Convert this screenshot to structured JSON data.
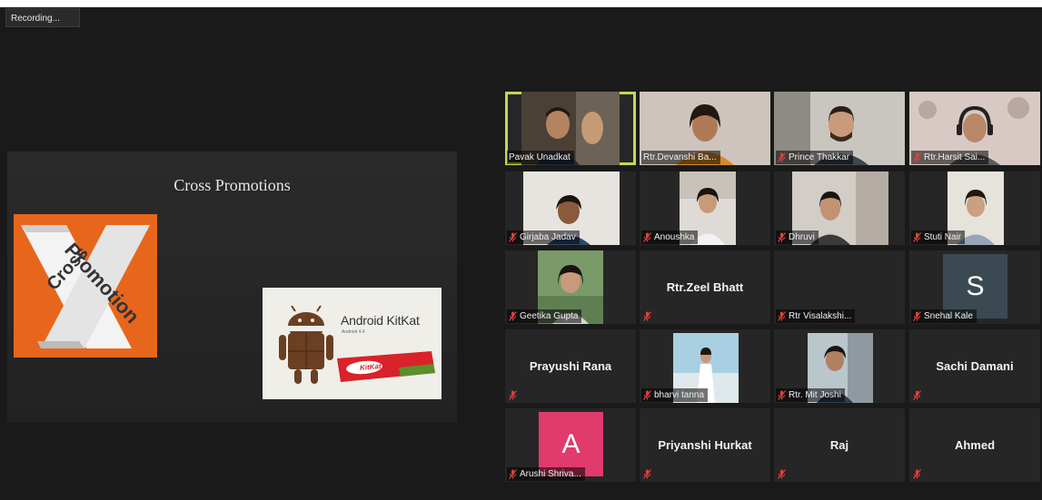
{
  "recording_label": "Recording...",
  "slide": {
    "title": "Cross Promotions",
    "logo_text": "Promotion Cross",
    "kitkat_title": "Android KitKat",
    "kitkat_sub": "Android 4.4",
    "kitkat_wrapper": "KitKat"
  },
  "colors": {
    "active_speaker": "#c8d94a",
    "muted_mic": "#e0403a",
    "tile_bg": "#262626",
    "avatar_snehal": "#3b4a52",
    "avatar_arushi": "#e13a6d"
  },
  "participants": [
    {
      "name": "Pavak Unadkat",
      "video": true,
      "muted": false,
      "active": true
    },
    {
      "name": "Rtr.Devanshi Ba...",
      "video": true,
      "muted": false
    },
    {
      "name": "Prince Thakkar",
      "video": true,
      "muted": true
    },
    {
      "name": "Rtr.Harsit Sai...",
      "video": true,
      "muted": true
    },
    {
      "name": "Girjaba Jadav",
      "video": true,
      "muted": true
    },
    {
      "name": "Anoushka",
      "video": true,
      "muted": true
    },
    {
      "name": "Dhruvi",
      "video": true,
      "muted": true
    },
    {
      "name": "Stuti Nair",
      "video": true,
      "muted": true
    },
    {
      "name": "Geetika Gupta",
      "video": true,
      "muted": true
    },
    {
      "name": "Rtr.Zeel Bhatt",
      "video": false,
      "muted": true
    },
    {
      "name": "Rtr Visalakshi...",
      "video": false,
      "muted": true
    },
    {
      "name": "Snehal Kale",
      "video": false,
      "muted": true,
      "avatar_letter": "S"
    },
    {
      "name": "Prayushi Rana",
      "video": false,
      "muted": true
    },
    {
      "name": "bharvi tanna",
      "video": true,
      "muted": true
    },
    {
      "name": "Rtr. Mit Joshi",
      "video": true,
      "muted": true
    },
    {
      "name": "Sachi Damani",
      "video": false,
      "muted": true
    },
    {
      "name": "Arushi Shriva...",
      "video": false,
      "muted": true,
      "avatar_letter": "A"
    },
    {
      "name": "Priyanshi Hurkat",
      "video": false,
      "muted": true
    },
    {
      "name": "Raj",
      "video": false,
      "muted": true
    },
    {
      "name": "Ahmed",
      "video": false,
      "muted": true
    }
  ]
}
